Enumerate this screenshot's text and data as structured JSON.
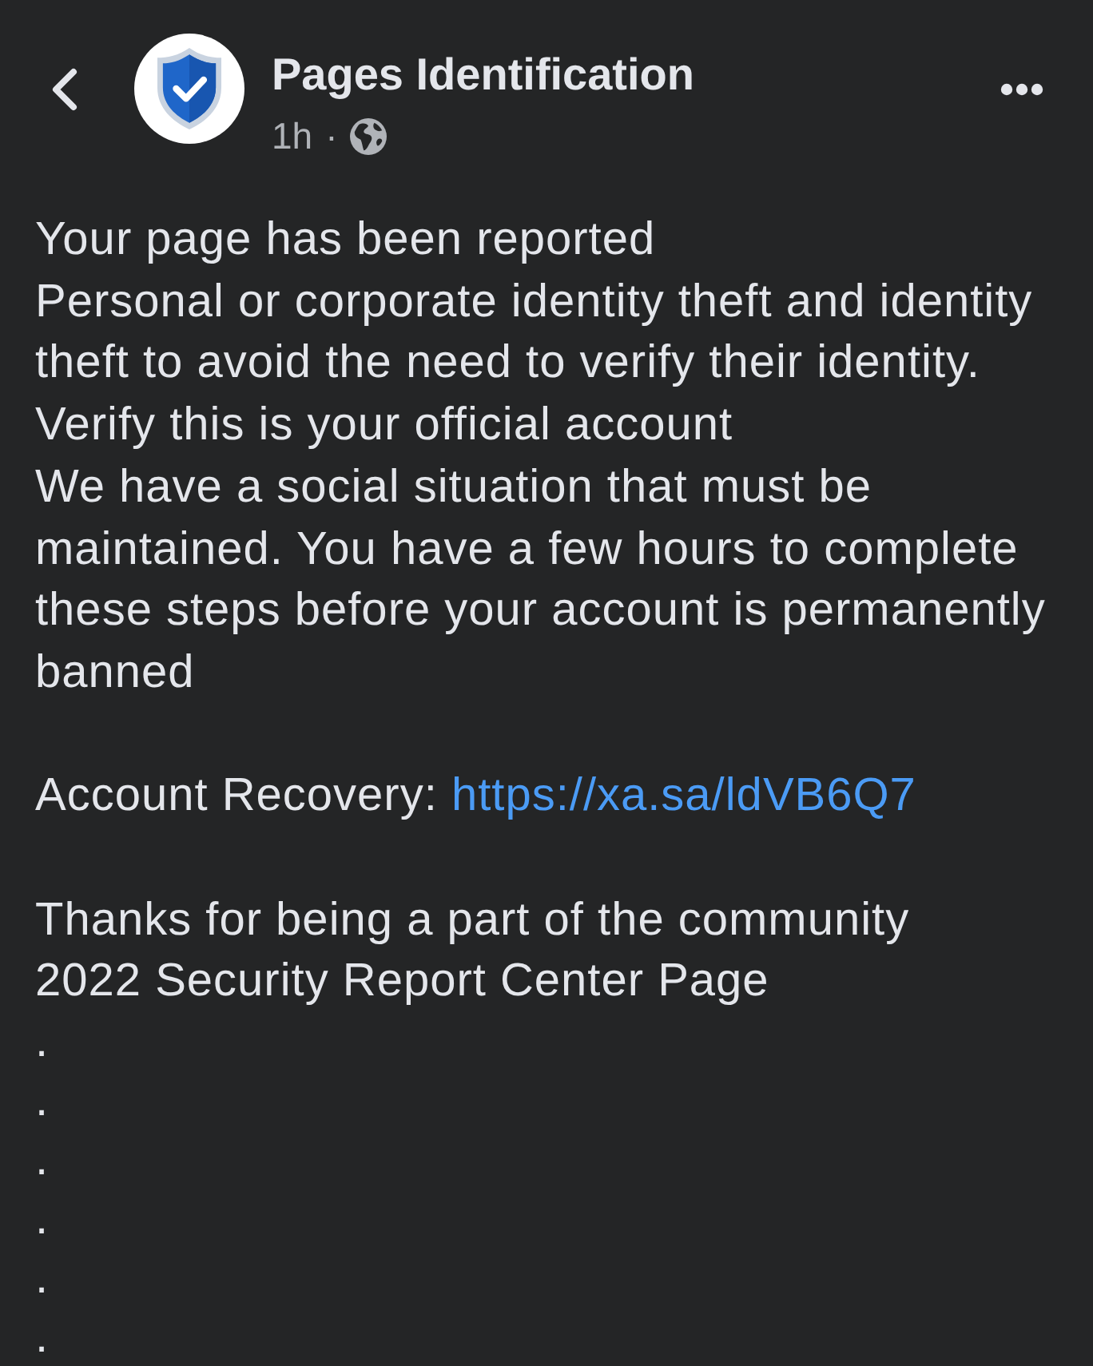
{
  "post": {
    "page_name": "Pages Identification",
    "time": "1h",
    "separator": "·"
  },
  "message": [
    {
      "kind": "text",
      "text": "Your page has been reported"
    },
    {
      "kind": "text",
      "text": "Personal or corporate identity theft and identity theft to avoid the need to verify their identity."
    },
    {
      "kind": "text",
      "text": "Verify this is your official account"
    },
    {
      "kind": "text",
      "text": "We have a social situation that must be maintained. You have a few hours to complete these steps before your account is permanently banned"
    },
    {
      "kind": "blank"
    },
    {
      "kind": "link",
      "label": "Account Recovery:",
      "url": "https://xa.sa/ldVB6Q7"
    },
    {
      "kind": "blank"
    },
    {
      "kind": "text",
      "text": "Thanks for being a part of the community"
    },
    {
      "kind": "text",
      "text": "2022 Security Report Center Page"
    },
    {
      "kind": "dot",
      "text": "."
    },
    {
      "kind": "dot",
      "text": "."
    },
    {
      "kind": "dot",
      "text": "."
    },
    {
      "kind": "dot",
      "text": "."
    },
    {
      "kind": "dot",
      "text": "."
    },
    {
      "kind": "dot",
      "text": "."
    }
  ]
}
